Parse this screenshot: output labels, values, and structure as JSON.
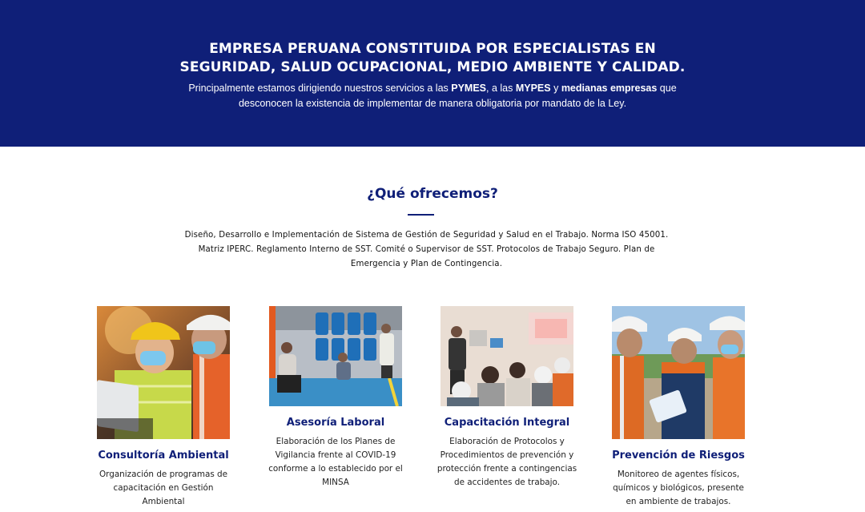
{
  "hero": {
    "title_line1": "EMPRESA PERUANA CONSTITUIDA POR ESPECIALISTAS EN",
    "title_line2": "SEGURIDAD, SALUD OCUPACIONAL, MEDIO AMBIENTE Y CALIDAD.",
    "intro_prefix": "Principalmente estamos dirigiendo nuestros servicios a las ",
    "intro_pymes": "PYMES",
    "intro_mid": ", a las ",
    "intro_mypes": "MYPES",
    "intro_and": " y ",
    "intro_medianas": "medianas empresas",
    "intro_suffix": " que",
    "intro_line2": "desconocen la existencia de implementar de manera obligatoria por mandato de la Ley."
  },
  "offer": {
    "title": "¿Qué ofrecemos?",
    "desc_line1": "Diseño, Desarrollo e Implementación de Sistema de Gestión de Seguridad y Salud en el Trabajo. Norma ISO 45001.",
    "desc_line2": "Matriz IPERC. Reglamento Interno de SST. Comité o Supervisor de SST. Protocolos de Trabajo Seguro. Plan de",
    "desc_line3": "Emergencia y Plan de Contingencia."
  },
  "services": [
    {
      "title": "Consultoría Ambiental",
      "desc": [
        "Organización de programas de",
        "capacitación en Gestión",
        "Ambiental"
      ],
      "image": "workers-hardhat-laptop-photo"
    },
    {
      "title": "Asesoría Laboral",
      "desc": [
        "Elaboración de los Planes de",
        "Vigilancia frente al COVID-19",
        "conforme a lo establecido por el",
        "MINSA"
      ],
      "image": "warehouse-barrels-meeting-photo"
    },
    {
      "title": "Capacitación Integral",
      "desc": [
        "Elaboración de Protocolos y",
        "Procedimientos de prevención y",
        "protección frente a contingencias",
        "de accidentes de trabajo."
      ],
      "image": "classroom-training-photo"
    },
    {
      "title": "Prevención de Riesgos",
      "desc": [
        "Monitoreo de agentes físicos,",
        "químicos y biológicos, presente",
        "en ambiente de trabajos."
      ],
      "image": "field-inspection-workers-photo"
    }
  ],
  "colors": {
    "brand_navy": "#0f1f78",
    "text_dark": "#222222",
    "background": "#ffffff"
  }
}
